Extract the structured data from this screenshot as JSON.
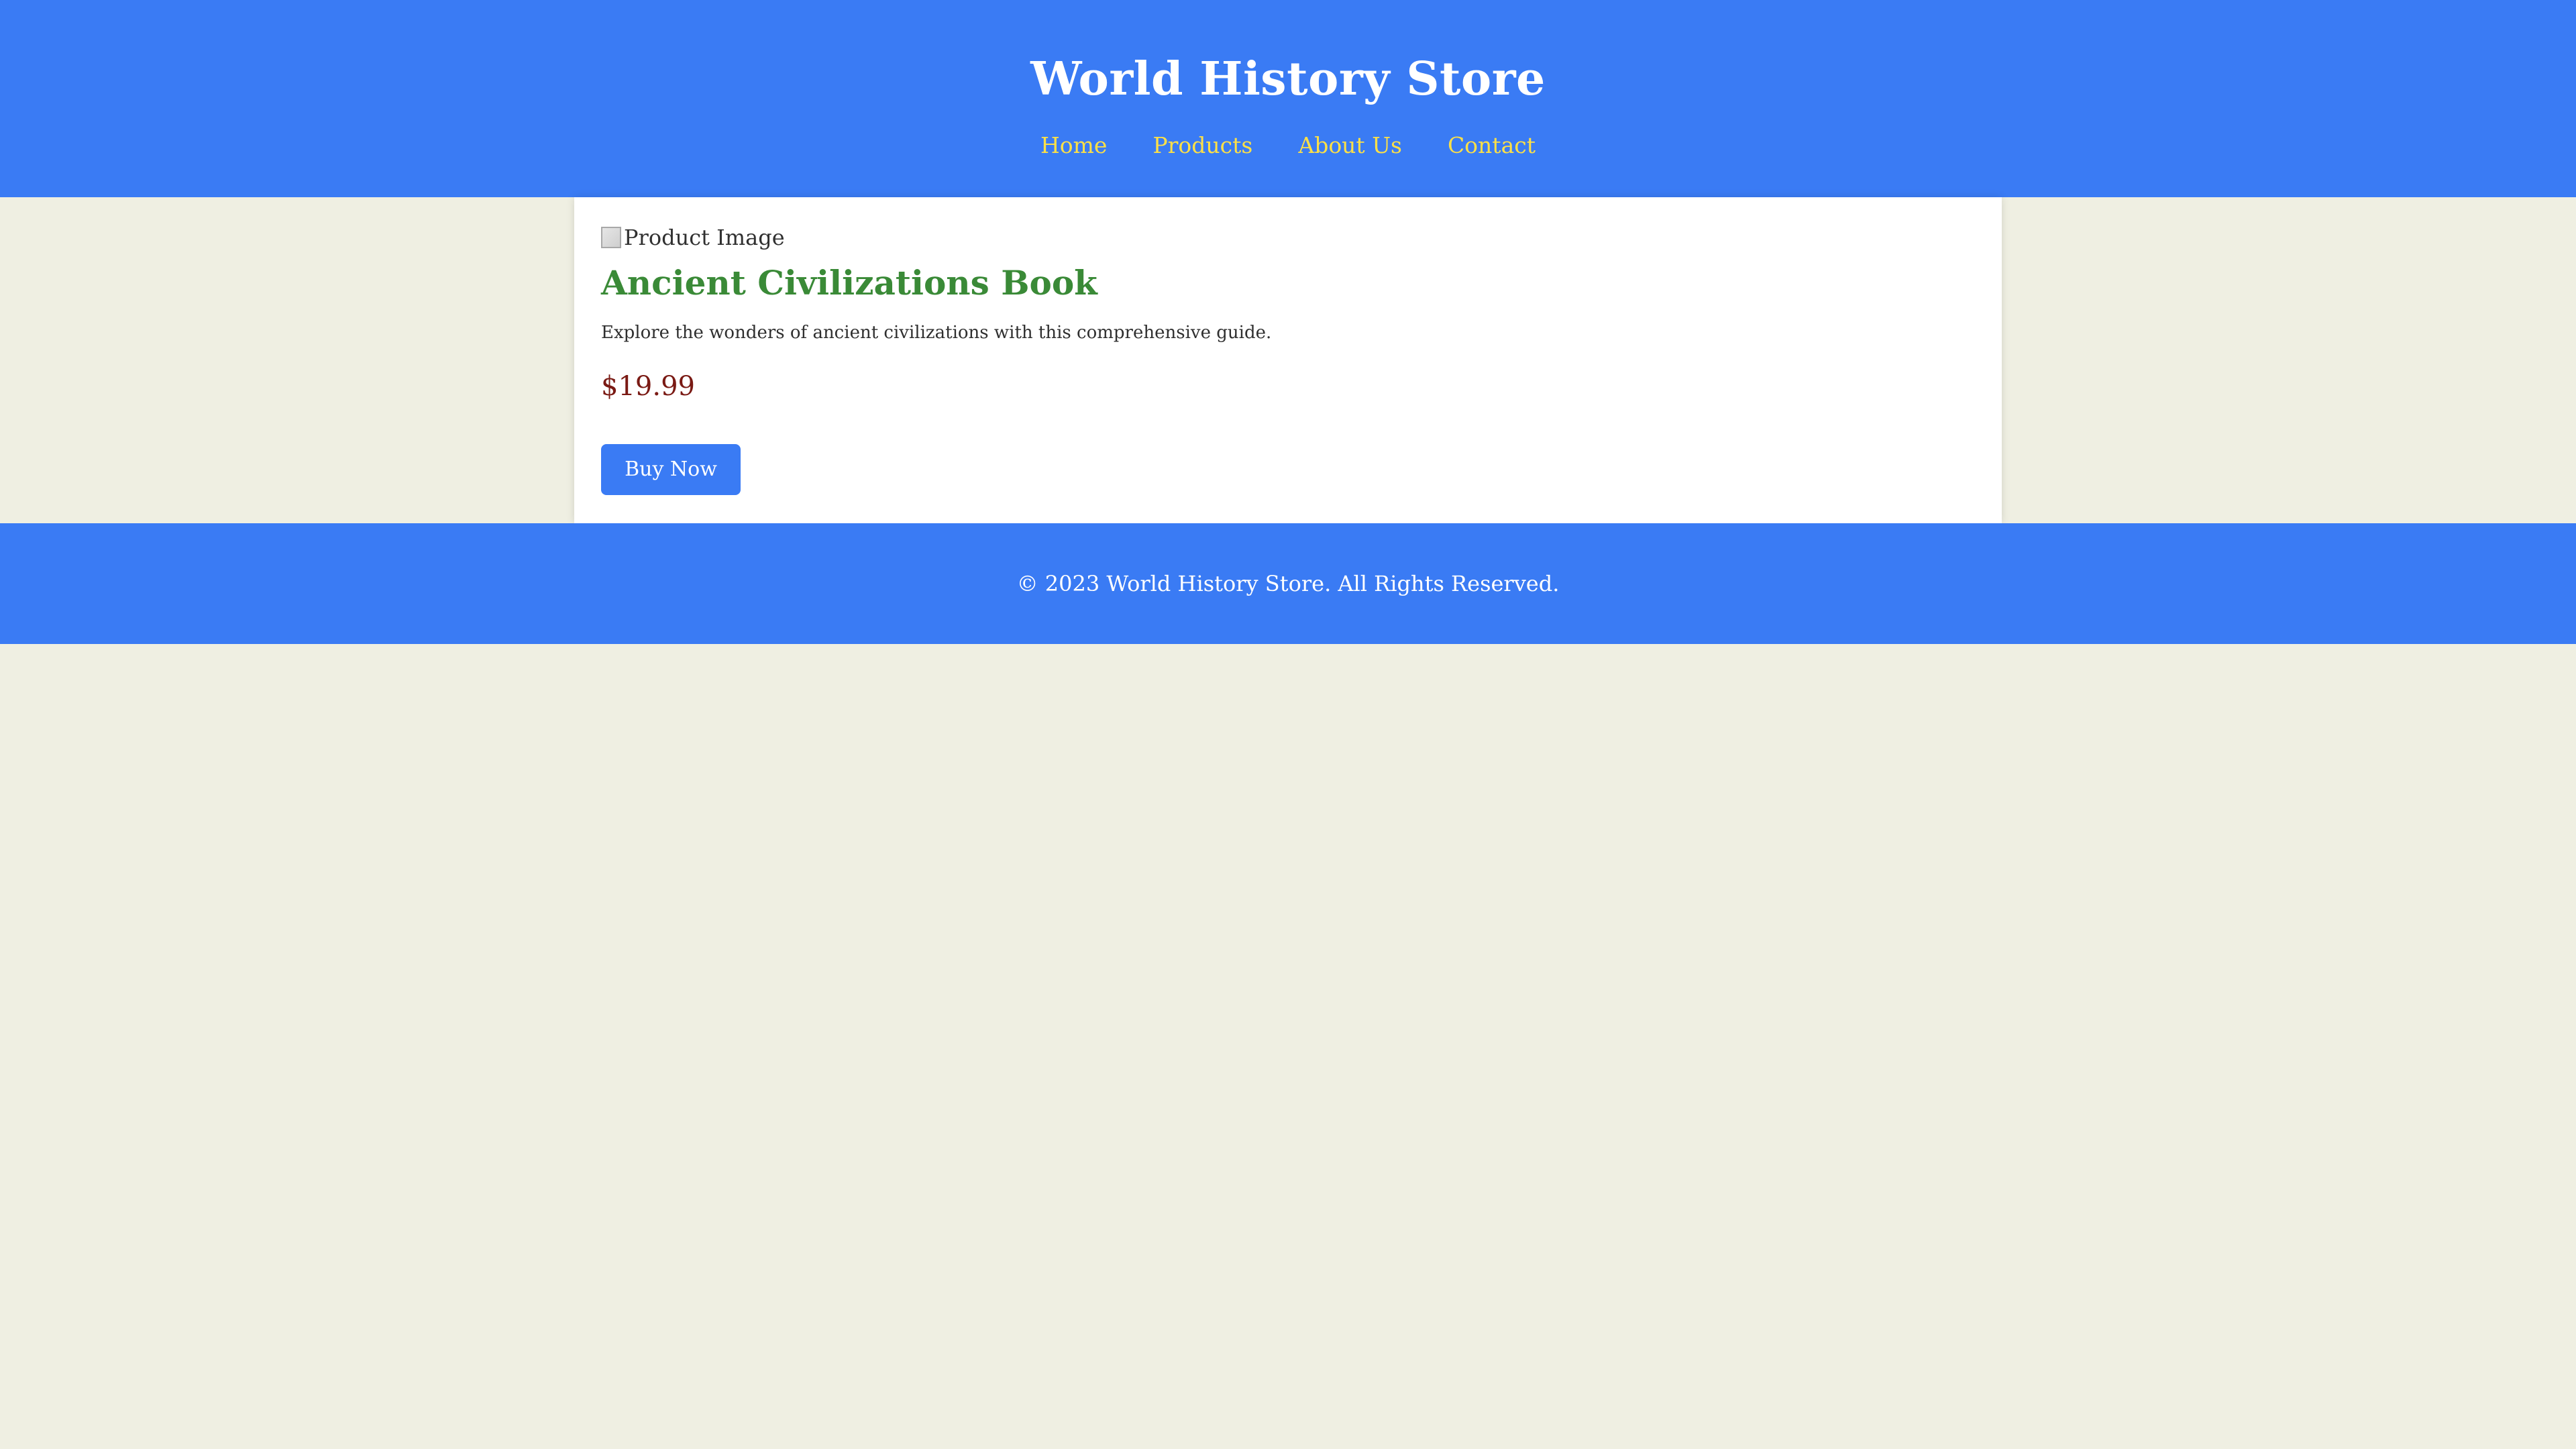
{
  "header": {
    "title": "World History Store",
    "nav": [
      {
        "label": "Home"
      },
      {
        "label": "Products"
      },
      {
        "label": "About Us"
      },
      {
        "label": "Contact"
      }
    ]
  },
  "product": {
    "image_alt": "Product Image",
    "title": "Ancient Civilizations Book",
    "description": "Explore the wonders of ancient civilizations with this comprehensive guide.",
    "price": "$19.99",
    "buy_label": "Buy Now"
  },
  "footer": {
    "text": "© 2023 World History Store. All Rights Reserved."
  },
  "colors": {
    "brand_blue": "#3a7bf4",
    "nav_link": "#fde047",
    "title_green": "#3a8a37",
    "price_red": "#7a1a14",
    "page_bg": "#efefe2"
  }
}
